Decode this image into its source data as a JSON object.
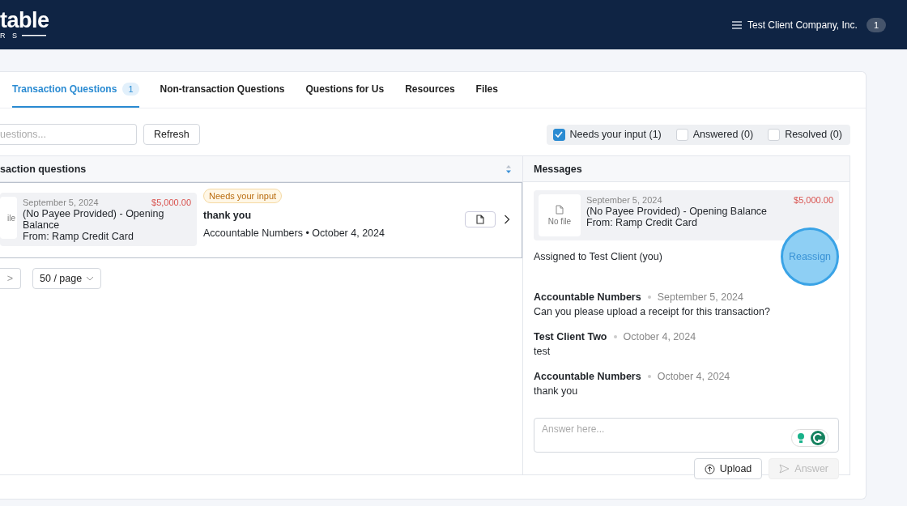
{
  "header": {
    "logo_text": "table",
    "logo_subtext": "R S",
    "account": "Test Client Company, Inc.",
    "badge": "1"
  },
  "tabs": [
    {
      "label": "Transaction Questions",
      "count": "1",
      "selected": true
    },
    {
      "label": "Non-transaction Questions",
      "selected": false
    },
    {
      "label": "Questions for Us",
      "selected": false
    },
    {
      "label": "Resources",
      "selected": false
    },
    {
      "label": "Files",
      "selected": false
    }
  ],
  "search": {
    "placeholder": "uestions..."
  },
  "refresh_button": "Refresh",
  "filters": [
    {
      "label": "Needs your input (1)",
      "checked": true
    },
    {
      "label": "Answered (0)",
      "checked": false
    },
    {
      "label": "Resolved (0)",
      "checked": false
    }
  ],
  "list": {
    "title": "saction questions",
    "rows": [
      {
        "file_label": "ile",
        "date": "September 5, 2024",
        "amount": "$5,000.00",
        "description": "(No Payee Provided)  -  Opening Balance",
        "source": "From: Ramp Credit Card",
        "status": "Needs your input",
        "last_message": "thank you",
        "meta": "Accountable Numbers • October 4, 2024",
        "selected": true
      }
    ]
  },
  "pagination": {
    "next": ">",
    "page_size": "50 / page"
  },
  "messages": {
    "title": "Messages",
    "transaction": {
      "file_label": "No file",
      "date": "September 5, 2024",
      "amount": "$5,000.00",
      "description": "(No Payee Provided)  -  Opening Balance",
      "source": "From: Ramp Credit Card"
    },
    "assigned": "Assigned to Test Client (you)",
    "reassign": "Reassign",
    "thread": [
      {
        "author": "Accountable Numbers",
        "date": "September 5, 2024",
        "text": "Can you please upload a receipt for this transaction?"
      },
      {
        "author": "Test Client Two",
        "date": "October 4, 2024",
        "text": "test"
      },
      {
        "author": "Accountable Numbers",
        "date": "October 4, 2024",
        "text": "thank you"
      }
    ],
    "answer_placeholder": "Answer here...",
    "upload": "Upload",
    "answer": "Answer",
    "answer_disabled": true
  }
}
